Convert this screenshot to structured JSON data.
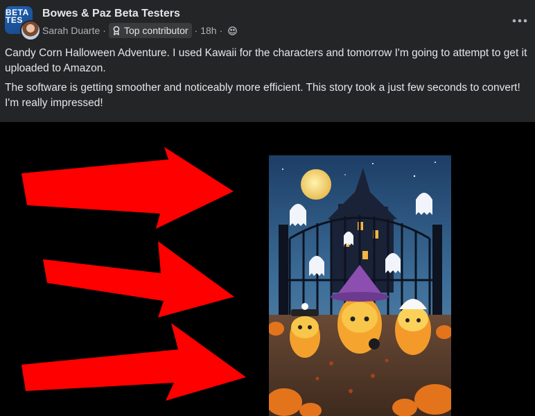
{
  "post": {
    "group_name": "Bowes & Paz Beta Testers",
    "group_avatar_text_line1": "BETA",
    "group_avatar_text_line2": "TES",
    "author": "Sarah Duarte",
    "separator": "·",
    "badge_label": "Top contributor",
    "time": "18h",
    "paragraphs": [
      "Candy Corn Halloween Adventure. I used Kawaii for the characters and tomorrow I'm going to attempt to get it uploaded to Amazon.",
      "The software is getting smoother and noticeably more efficient. This story took a just few seconds to convert! I'm really impressed!"
    ]
  },
  "icons": {
    "badge": "contributor-badge-icon",
    "privacy": "globe-icon",
    "menu": "more-options-icon"
  },
  "colors": {
    "card_bg": "#242526",
    "primary_text": "#e4e6eb",
    "secondary_text": "#b0b3b8",
    "badge_bg": "#3a3b3c",
    "arrow": "#ff0000"
  }
}
